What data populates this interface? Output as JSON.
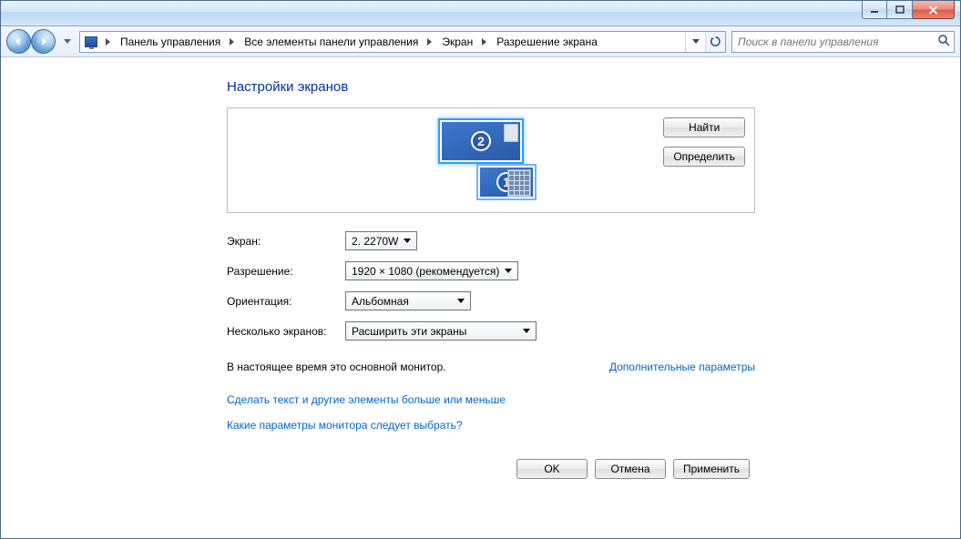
{
  "breadcrumbs": {
    "b0": "Панель управления",
    "b1": "Все элементы панели управления",
    "b2": "Экран",
    "b3": "Разрешение экрана"
  },
  "search": {
    "placeholder": "Поиск в панели управления"
  },
  "page_title": "Настройки экранов",
  "preview_buttons": {
    "find": "Найти",
    "identify": "Определить"
  },
  "monitors": {
    "num1": "1",
    "num2": "2"
  },
  "form": {
    "screen_label": "Экран:",
    "screen_value": "2. 2270W",
    "resolution_label": "Разрешение:",
    "resolution_value": "1920 × 1080 (рекомендуется)",
    "orientation_label": "Ориентация:",
    "orientation_value": "Альбомная",
    "multiple_label": "Несколько экранов:",
    "multiple_value": "Расширить эти экраны"
  },
  "status_text": "В настоящее время это основной монитор.",
  "link_advanced": "Дополнительные параметры",
  "link_textsize": "Сделать текст и другие элементы больше или меньше",
  "link_help": "Какие параметры монитора следует выбрать?",
  "footer": {
    "ok": "OK",
    "cancel": "Отмена",
    "apply": "Применить"
  }
}
